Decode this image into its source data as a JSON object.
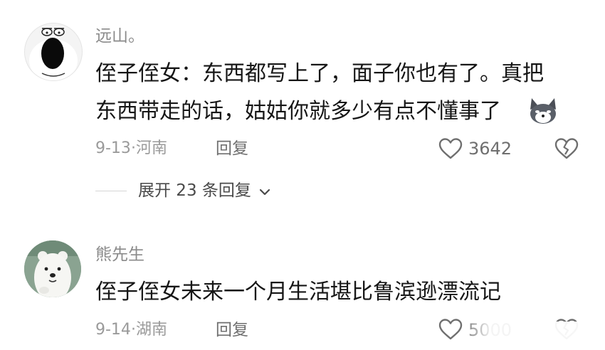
{
  "comments": [
    {
      "username": "远山。",
      "text_line1": "侄子侄女：东西都写上了，面子你也有了。真把",
      "text_line2": "东西带走的话，姑姑你就多少有点不懂事了",
      "date": "9-13",
      "location": "河南",
      "reply_label": "回复",
      "like_count": "3642",
      "expand_label": "展开 23 条回复"
    },
    {
      "username": "熊先生",
      "text_line1": "侄子侄女未来一个月生活堪比鲁滨逊漂流记",
      "date": "9-14",
      "location": "湖南",
      "reply_label": "回复",
      "like_count": "5000"
    }
  ],
  "meta_separator": "·"
}
